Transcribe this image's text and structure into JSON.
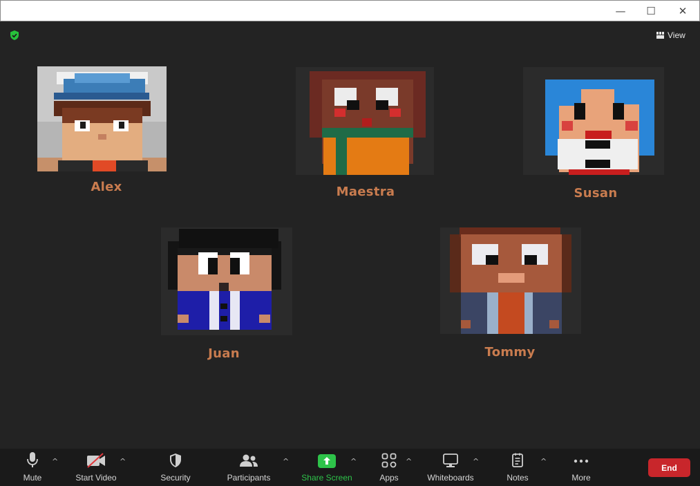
{
  "window": {
    "minimize_glyph": "—",
    "maximize_glyph": "☐",
    "close_glyph": "✕"
  },
  "header": {
    "view_label": "View",
    "encryption_icon": "shield-check-icon"
  },
  "participants": [
    {
      "name": "Alex"
    },
    {
      "name": "Maestra"
    },
    {
      "name": "Susan"
    },
    {
      "name": "Juan"
    },
    {
      "name": "Tommy"
    }
  ],
  "toolbar": {
    "mute": "Mute",
    "start_video": "Start Video",
    "security": "Security",
    "participants": "Participants",
    "share_screen": "Share Screen",
    "apps": "Apps",
    "whiteboards": "Whiteboards",
    "notes": "Notes",
    "more": "More",
    "end": "End",
    "caret": "^"
  },
  "colors": {
    "background": "#232323",
    "toolbar": "#1a1a1a",
    "name_text": "#c97c4f",
    "share_green": "#2ec34a",
    "end_red": "#c8262b",
    "secure_green": "#27c13b"
  }
}
